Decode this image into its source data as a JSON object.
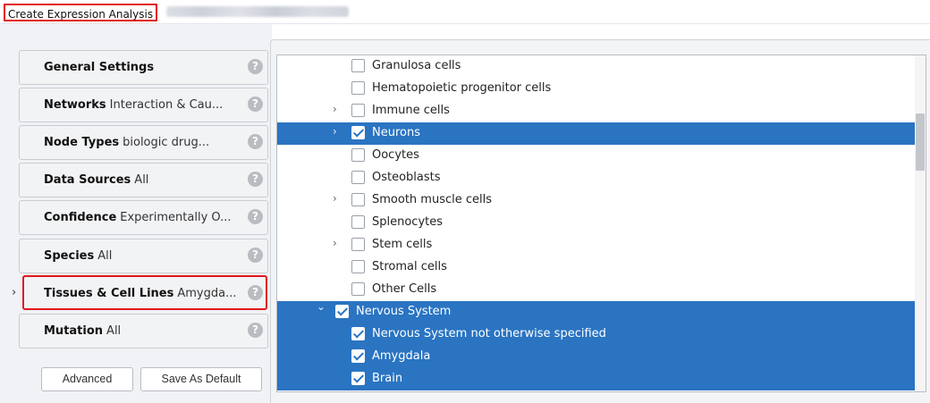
{
  "window": {
    "title": "Create Expression Analysis",
    "subtitle_obscured": ""
  },
  "nav": {
    "items": [
      {
        "title": "General Settings",
        "summary": ""
      },
      {
        "title": "Networks",
        "summary": "Interaction & Cau..."
      },
      {
        "title": "Node Types",
        "summary": "biologic drug..."
      },
      {
        "title": "Data Sources",
        "summary": "All"
      },
      {
        "title": "Confidence",
        "summary": "Experimentally O..."
      },
      {
        "title": "Species",
        "summary": "All"
      },
      {
        "title": "Tissues & Cell Lines",
        "summary": "Amygda..."
      },
      {
        "title": "Mutation",
        "summary": "All"
      }
    ],
    "active_index": 6,
    "help_glyph": "?",
    "arrow_glyph": "›"
  },
  "buttons": {
    "advanced": "Advanced",
    "save_default": "Save As Default"
  },
  "tree": {
    "rows": [
      {
        "label": "Granulosa cells",
        "level": 1,
        "expandable": false,
        "checked": false,
        "selected": false
      },
      {
        "label": "Hematopoietic progenitor cells",
        "level": 1,
        "expandable": false,
        "checked": false,
        "selected": false
      },
      {
        "label": "Immune cells",
        "level": 1,
        "expandable": true,
        "expanded": false,
        "checked": false,
        "selected": false
      },
      {
        "label": "Neurons",
        "level": 1,
        "expandable": true,
        "expanded": false,
        "checked": true,
        "selected": true
      },
      {
        "label": "Oocytes",
        "level": 1,
        "expandable": false,
        "checked": false,
        "selected": false
      },
      {
        "label": "Osteoblasts",
        "level": 1,
        "expandable": false,
        "checked": false,
        "selected": false
      },
      {
        "label": "Smooth muscle cells",
        "level": 1,
        "expandable": true,
        "expanded": false,
        "checked": false,
        "selected": false
      },
      {
        "label": "Splenocytes",
        "level": 1,
        "expandable": false,
        "checked": false,
        "selected": false
      },
      {
        "label": "Stem cells",
        "level": 1,
        "expandable": true,
        "expanded": false,
        "checked": false,
        "selected": false
      },
      {
        "label": "Stromal cells",
        "level": 1,
        "expandable": false,
        "checked": false,
        "selected": false
      },
      {
        "label": "Other Cells",
        "level": 1,
        "expandable": false,
        "checked": false,
        "selected": false
      },
      {
        "label": "Nervous System",
        "level": 0,
        "expandable": true,
        "expanded": true,
        "checked": true,
        "selected": true
      },
      {
        "label": "Nervous System not otherwise specified",
        "level": 1,
        "expandable": false,
        "checked": true,
        "selected": true
      },
      {
        "label": "Amygdala",
        "level": 1,
        "expandable": false,
        "checked": true,
        "selected": true
      },
      {
        "label": "Brain",
        "level": 1,
        "expandable": false,
        "checked": true,
        "selected": true
      }
    ],
    "chevron_collapsed": "›",
    "chevron_expanded": "⌄"
  },
  "colors": {
    "selection": "#2a74c2",
    "highlight_outline": "#e0181e",
    "help_icon": "#b9bcc1"
  }
}
